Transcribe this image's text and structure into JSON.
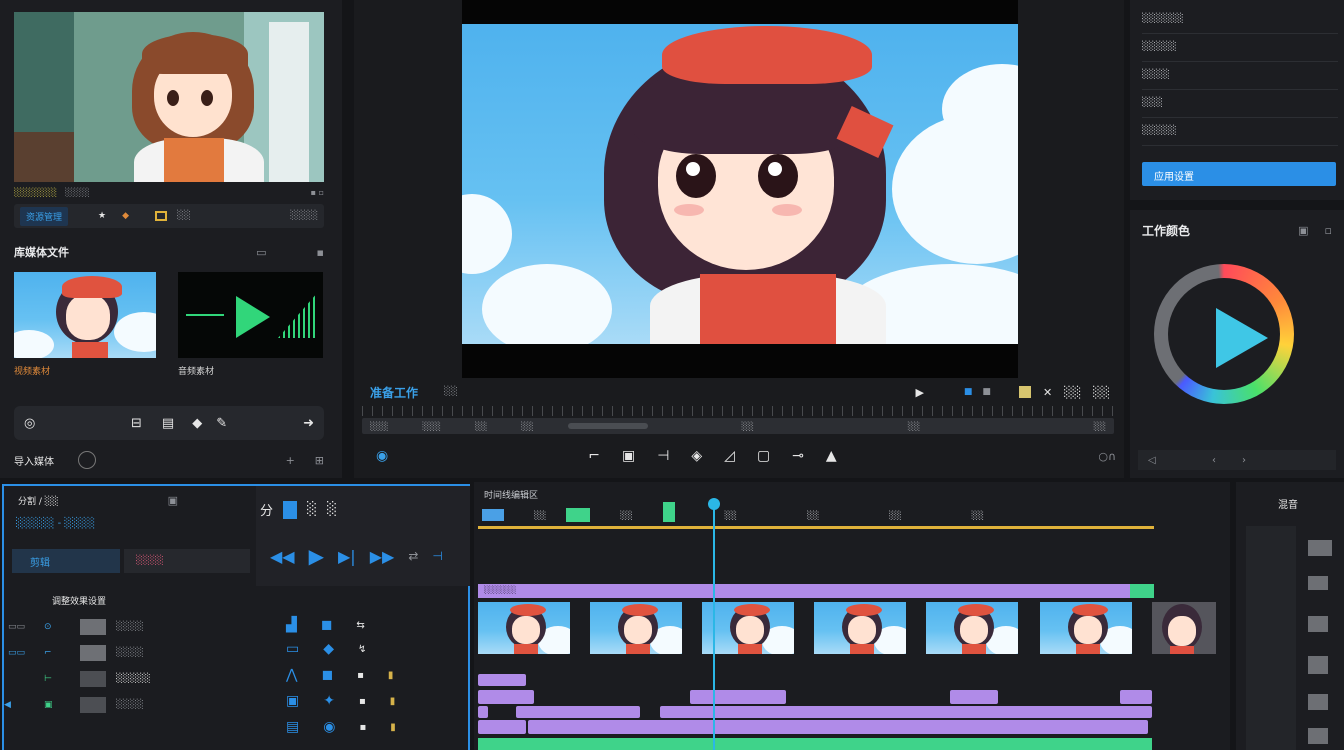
{
  "source_panel": {
    "clip_labels": [
      "░░░░░░░",
      "░░░░"
    ],
    "toolbar": [
      "资源管理",
      "★",
      "◆",
      "░░",
      "░░░░"
    ],
    "section_title": "库媒体文件",
    "media": [
      {
        "label": "视频素材"
      },
      {
        "label": "音频素材"
      }
    ],
    "footer_label": "导入媒体"
  },
  "preview": {
    "title": "准备工作",
    "subtitle": "░░",
    "right_tools": [
      "▶",
      "■",
      "■",
      "✕",
      "░░",
      "░░"
    ],
    "scrub_labels": [
      "░░░",
      "░░░",
      "░░",
      "░░",
      "░░",
      "░░",
      "░░"
    ]
  },
  "properties": {
    "rows": [
      "░░░░░░",
      "░░░░░",
      "░░░░",
      "░░░",
      "░░░░░"
    ],
    "apply_button": "应用设置",
    "color_title": "工作颜色"
  },
  "edit_panel": {
    "header": "分割 / ░░",
    "breadcrumb": "░░░░░ - ░░░░",
    "tab_active": "剪辑",
    "tab_other": "░░░░",
    "list_title": "调整效果设置",
    "list_items": [
      "░░░░",
      "░░░░",
      "░░░░░",
      "░░░░"
    ],
    "transport_labels": [
      "分",
      "░",
      "░"
    ]
  },
  "timeline": {
    "title": "时间线编辑区",
    "ruler_labels": [
      "░░",
      "░░",
      "░░",
      "░░",
      "░░",
      "░░"
    ],
    "track_label": "░░░░░░"
  },
  "mixer": {
    "title": "混音"
  },
  "colors": {
    "accent": "#2b8fe6",
    "green": "#3fd38a",
    "purple": "#b08be8",
    "playhead": "#2bb7e6"
  }
}
